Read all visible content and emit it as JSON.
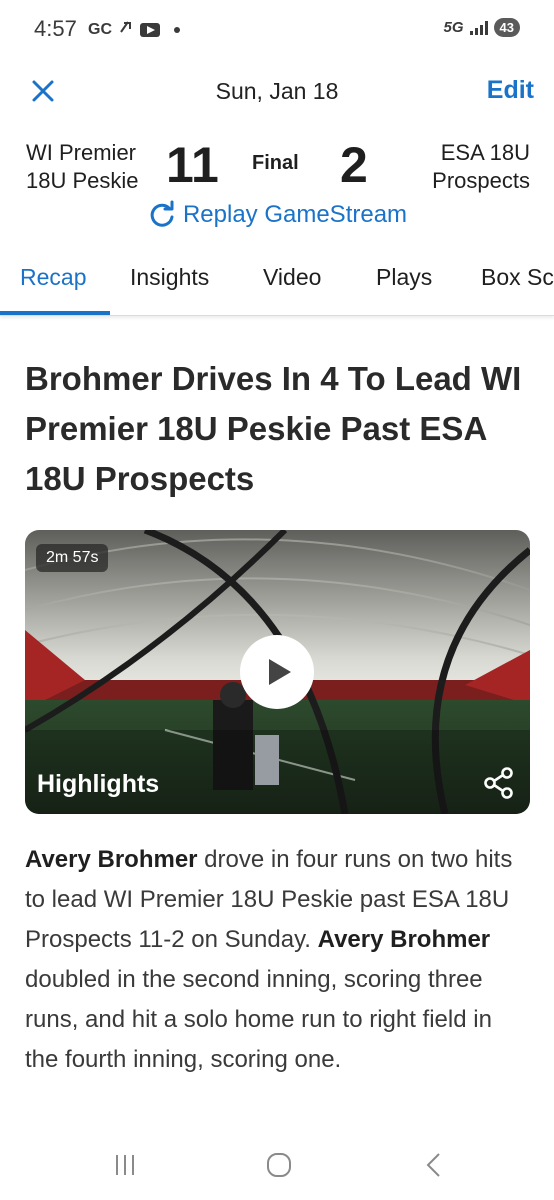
{
  "status_bar": {
    "time": "4:57",
    "left_icons": [
      "GC",
      "ᵃ⁺"
    ],
    "network": "5G",
    "battery": "43"
  },
  "header": {
    "close_icon": "close-icon",
    "date": "Sun, Jan 18",
    "edit_label": "Edit"
  },
  "scoreboard": {
    "home_team_line1": "WI Premier",
    "home_team_line2": "18U Peskie",
    "home_score": "11",
    "status": "Final",
    "away_score": "2",
    "away_team_line1": "ESA 18U",
    "away_team_line2": "Prospects",
    "replay_label": "Replay GameStream"
  },
  "tabs": [
    {
      "label": "Recap",
      "active": true
    },
    {
      "label": "Insights",
      "active": false
    },
    {
      "label": "Video",
      "active": false
    },
    {
      "label": "Plays",
      "active": false
    },
    {
      "label": "Box Sc",
      "active": false
    }
  ],
  "article": {
    "headline": "Brohmer Drives In 4 To Lead WI Premier 18U Peskie Past ESA 18U Prospects",
    "video": {
      "duration": "2m 57s",
      "label": "Highlights"
    },
    "recap": {
      "p1_name": "Avery Brohmer",
      "p1_text": " drove in four runs on two hits to lead WI Premier 18U Peskie past ESA 18U Prospects 11-2 on Sunday.",
      "p2_name": "Avery Brohmer",
      "p2_text": " doubled in the second inning, scoring three runs, and hit a solo home run to right field in the fourth inning, scoring one."
    }
  },
  "colors": {
    "accent": "#1a73c8",
    "text": "#1f1f1f"
  }
}
